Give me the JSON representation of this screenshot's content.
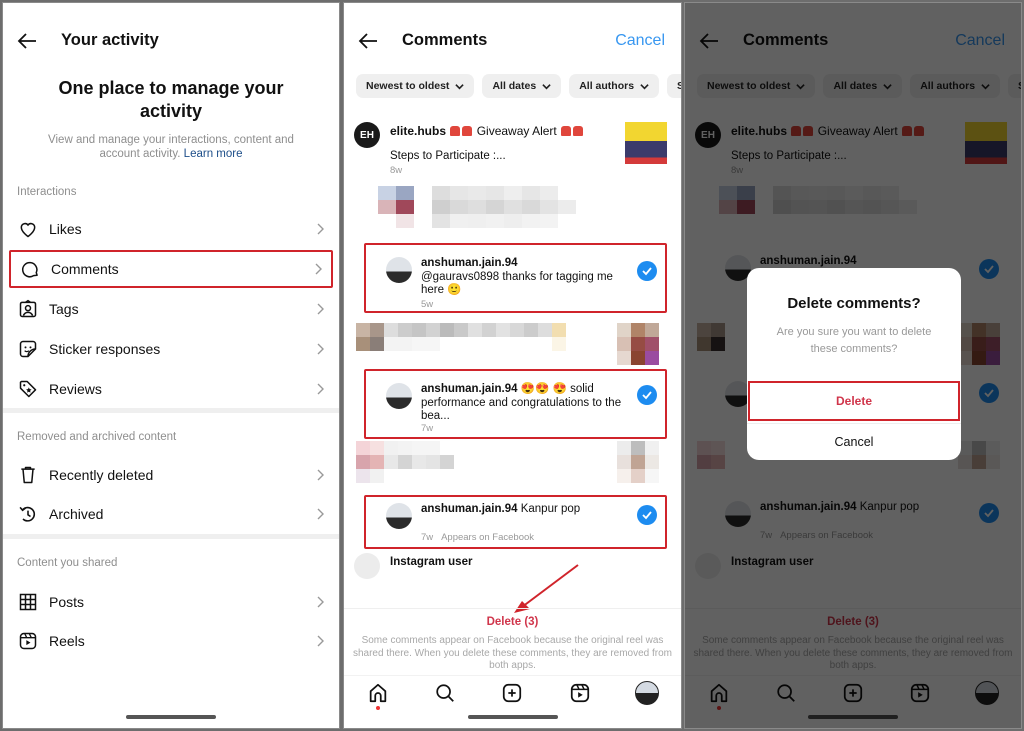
{
  "activity": {
    "title": "Your activity",
    "hero_title_line1": "One place to manage your",
    "hero_title_line2": "activity",
    "hero_sub": "View and manage your interactions, content and account activity.",
    "learn_more": "Learn more",
    "sections": [
      {
        "label": "Interactions",
        "items": [
          {
            "label": "Likes",
            "icon": "heart-icon"
          },
          {
            "label": "Comments",
            "icon": "comment-icon",
            "highlighted": true
          },
          {
            "label": "Tags",
            "icon": "tag-person-icon"
          },
          {
            "label": "Sticker responses",
            "icon": "sticker-icon"
          },
          {
            "label": "Reviews",
            "icon": "review-tag-icon"
          }
        ]
      },
      {
        "label": "Removed and archived content",
        "items": [
          {
            "label": "Recently deleted",
            "icon": "trash-icon"
          },
          {
            "label": "Archived",
            "icon": "archive-history-icon"
          }
        ]
      },
      {
        "label": "Content you shared",
        "items": [
          {
            "label": "Posts",
            "icon": "grid-icon"
          },
          {
            "label": "Reels",
            "icon": "reels-icon"
          }
        ]
      }
    ]
  },
  "comments": {
    "title": "Comments",
    "cancel": "Cancel",
    "filters": [
      "Newest to oldest",
      "All dates",
      "All authors",
      "Shared"
    ],
    "post": {
      "avatar_text": "EH",
      "username": "elite.hubs",
      "caption": "Giveaway Alert",
      "subtext": "Steps to Participate :...",
      "time": "8w"
    },
    "items": [
      {
        "username": "anshuman.jain.94",
        "text": "@gauravs0898 thanks for tagging me here 🙂",
        "time": "5w",
        "extra": "",
        "checked": true
      },
      {
        "username": "anshuman.jain.94",
        "text": "😍😍 😍 solid performance and congratulations  to the bea...",
        "time": "7w",
        "extra": "",
        "checked": true
      },
      {
        "username": "anshuman.jain.94",
        "text": "Kanpur pop",
        "time": "7w",
        "extra": "Appears on Facebook",
        "checked": true
      }
    ],
    "instagram_user": "Instagram user",
    "delete_button": "Delete (3)",
    "note": "Some comments appear on Facebook because the original reel was shared there. When you delete these comments, they are removed from both apps."
  },
  "dialog": {
    "title": "Delete comments?",
    "message": "Are you sure you want to delete these comments?",
    "confirm": "Delete",
    "cancel": "Cancel"
  },
  "colors": {
    "accent_blue": "#3897f0",
    "check_blue": "#1d8cf0",
    "delete_red": "#d0354b",
    "highlight_red": "#d0242b"
  }
}
